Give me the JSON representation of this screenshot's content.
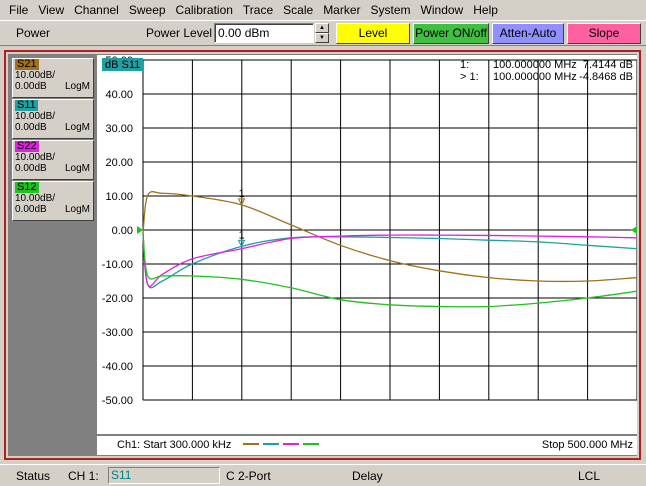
{
  "menu": [
    "File",
    "View",
    "Channel",
    "Sweep",
    "Calibration",
    "Trace",
    "Scale",
    "Marker",
    "System",
    "Window",
    "Help"
  ],
  "toolbar": {
    "title": "Power",
    "power_level_label": "Power Level",
    "power_level_value": "0.00 dBm",
    "buttons": [
      {
        "label": "Level",
        "color": "#ffff00"
      },
      {
        "label": "Power ON/off",
        "color": "#40c040"
      },
      {
        "label": "Atten-Auto",
        "color": "#9090ff"
      },
      {
        "label": "Slope",
        "color": "#ff60a0"
      }
    ]
  },
  "traces": [
    {
      "name": "S21",
      "scale": "10.00dB/",
      "ref": "0.00dB",
      "format": "LogM",
      "color": "#a0701a"
    },
    {
      "name": "S11",
      "scale": "10.00dB/",
      "ref": "0.00dB",
      "format": "LogM",
      "color": "#20a0a0"
    },
    {
      "name": "S22",
      "scale": "10.00dB/",
      "ref": "0.00dB",
      "format": "LogM",
      "color": "#e020e0"
    },
    {
      "name": "S12",
      "scale": "10.00dB/",
      "ref": "0.00dB",
      "format": "LogM",
      "color": "#20c020"
    }
  ],
  "plot": {
    "active_trace_label": "dB S11",
    "y_ticks": [
      "50.00",
      "40.00",
      "30.00",
      "20.00",
      "10.00",
      "0.00",
      "-10.00",
      "-20.00",
      "-30.00",
      "-40.00",
      "-50.00"
    ],
    "markers": [
      {
        "id": "1:",
        "freq": "100.000000 MHz",
        "value": "7.4144 dB",
        "color": "#a0701a"
      },
      {
        "id": "> 1:",
        "freq": "100.000000 MHz",
        "value": "-4.8468 dB",
        "color": "#20a0a0"
      }
    ],
    "marker_label": "1",
    "start_label": "Ch1: Start  300.000 kHz",
    "stop_label": "Stop  500.000 MHz"
  },
  "chart_data": {
    "type": "line",
    "xlabel": "",
    "ylabel": "",
    "x_range_mhz": [
      0.3,
      500
    ],
    "ylim": [
      -50,
      50
    ],
    "grid": true,
    "series": [
      {
        "name": "S21",
        "color": "#a0701a",
        "x": [
          0.3,
          5,
          20,
          50,
          100,
          150,
          200,
          250,
          300,
          350,
          400,
          450,
          500
        ],
        "y": [
          -1,
          10.2,
          10.8,
          10,
          7.4,
          1.5,
          -4.5,
          -9,
          -12,
          -14,
          -15,
          -15,
          -14
        ]
      },
      {
        "name": "S11",
        "color": "#20a0a0",
        "x": [
          0.3,
          5,
          20,
          50,
          100,
          150,
          200,
          250,
          300,
          350,
          400,
          450,
          500
        ],
        "y": [
          -1,
          -16,
          -15,
          -10,
          -4.8,
          -2.3,
          -2,
          -2.2,
          -2.5,
          -3,
          -3.5,
          -4.5,
          -5.5
        ]
      },
      {
        "name": "S22",
        "color": "#e020e0",
        "x": [
          0.3,
          5,
          20,
          50,
          100,
          150,
          200,
          250,
          300,
          350,
          400,
          450,
          500
        ],
        "y": [
          -1,
          -16,
          -13,
          -8.5,
          -5.5,
          -2.5,
          -1.8,
          -1.5,
          -1.5,
          -1.6,
          -1.8,
          -2,
          -2.3
        ]
      },
      {
        "name": "S12",
        "color": "#20c020",
        "x": [
          0.3,
          5,
          20,
          50,
          100,
          150,
          200,
          250,
          300,
          350,
          400,
          450,
          500
        ],
        "y": [
          -1,
          -13.5,
          -13.5,
          -13.5,
          -14.5,
          -17,
          -20.5,
          -22,
          -22.5,
          -22.5,
          -21.5,
          -20,
          -18
        ]
      }
    ],
    "reference_level": 0
  },
  "status": {
    "label": "Status",
    "channel": "CH 1:",
    "trace": "S11",
    "cal": "C  2-Port",
    "delay": "Delay",
    "remote": "LCL"
  }
}
